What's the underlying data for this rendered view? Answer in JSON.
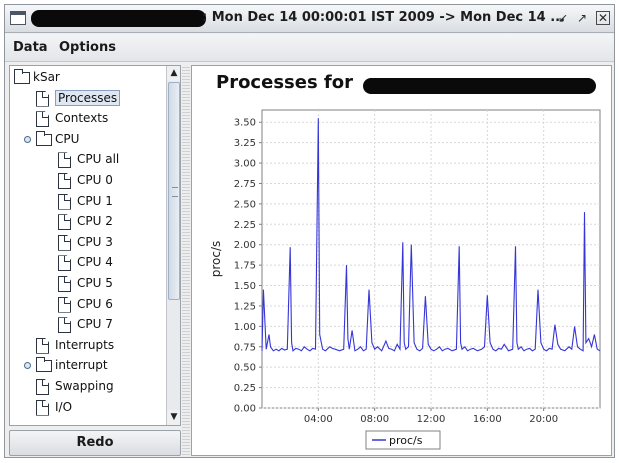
{
  "window": {
    "title": ": Mon Dec 14 00:00:01 IST 2009 -> Mon Dec 14 ..."
  },
  "menu": [
    {
      "label": "Data"
    },
    {
      "label": "Options"
    }
  ],
  "tree": {
    "items": [
      {
        "label": "kSar",
        "icon": "folder-icon",
        "level": 0
      },
      {
        "label": "Processes",
        "icon": "doc-icon",
        "level": 1,
        "selected": true
      },
      {
        "label": "Contexts",
        "icon": "doc-icon",
        "level": 1
      },
      {
        "label": "CPU",
        "icon": "folder-icon",
        "level": 1,
        "expanded": true
      },
      {
        "label": "CPU all",
        "icon": "doc-icon",
        "level": 2
      },
      {
        "label": "CPU 0",
        "icon": "doc-icon",
        "level": 2
      },
      {
        "label": "CPU 1",
        "icon": "doc-icon",
        "level": 2
      },
      {
        "label": "CPU 2",
        "icon": "doc-icon",
        "level": 2
      },
      {
        "label": "CPU 3",
        "icon": "doc-icon",
        "level": 2
      },
      {
        "label": "CPU 4",
        "icon": "doc-icon",
        "level": 2
      },
      {
        "label": "CPU 5",
        "icon": "doc-icon",
        "level": 2
      },
      {
        "label": "CPU 6",
        "icon": "doc-icon",
        "level": 2
      },
      {
        "label": "CPU 7",
        "icon": "doc-icon",
        "level": 2
      },
      {
        "label": "Interrupts",
        "icon": "doc-icon",
        "level": 1
      },
      {
        "label": "interrupt",
        "icon": "folder-icon",
        "level": 1,
        "expanded": false
      },
      {
        "label": "Swapping",
        "icon": "doc-icon",
        "level": 1
      },
      {
        "label": "I/O",
        "icon": "doc-icon",
        "level": 1
      }
    ]
  },
  "redo_label": "Redo",
  "chart_data": {
    "type": "line",
    "title": "Processes for ",
    "ylabel": "proc/s",
    "xlabel": "",
    "ylim": [
      0,
      3.65
    ],
    "y_ticks": [
      "0.00",
      "0.25",
      "0.50",
      "0.75",
      "1.00",
      "1.25",
      "1.50",
      "1.75",
      "2.00",
      "2.25",
      "2.50",
      "2.75",
      "3.00",
      "3.25",
      "3.50"
    ],
    "x_ticks": [
      "04:00",
      "08:00",
      "12:00",
      "16:00",
      "20:00"
    ],
    "x_tick_hours": [
      4,
      8,
      12,
      16,
      20
    ],
    "xlim_hours": [
      0,
      24
    ],
    "grid": true,
    "legend_position": "bottom",
    "color": "#3535d8",
    "series": [
      {
        "name": "proc/s",
        "x_hours": [
          0.0,
          0.1,
          0.3,
          0.5,
          0.6,
          0.8,
          1.0,
          1.2,
          1.4,
          1.6,
          1.8,
          2.0,
          2.1,
          2.2,
          2.4,
          2.6,
          2.8,
          3.0,
          3.2,
          3.4,
          3.6,
          3.8,
          4.0,
          4.1,
          4.3,
          4.5,
          4.8,
          5.0,
          5.2,
          5.5,
          5.8,
          6.0,
          6.1,
          6.2,
          6.4,
          6.6,
          6.8,
          7.0,
          7.2,
          7.4,
          7.6,
          7.8,
          8.0,
          8.2,
          8.5,
          8.8,
          9.0,
          9.2,
          9.4,
          9.6,
          9.8,
          10.0,
          10.1,
          10.2,
          10.4,
          10.6,
          10.8,
          11.0,
          11.2,
          11.4,
          11.6,
          11.8,
          12.0,
          12.2,
          12.4,
          12.6,
          12.8,
          13.0,
          13.2,
          13.5,
          13.8,
          14.0,
          14.1,
          14.2,
          14.4,
          14.6,
          14.8,
          15.0,
          15.3,
          15.6,
          15.8,
          16.0,
          16.2,
          16.4,
          16.6,
          16.8,
          17.0,
          17.2,
          17.5,
          17.8,
          18.0,
          18.1,
          18.2,
          18.4,
          18.6,
          18.8,
          19.0,
          19.2,
          19.4,
          19.6,
          19.8,
          20.0,
          20.2,
          20.4,
          20.6,
          20.8,
          21.0,
          21.2,
          21.5,
          21.8,
          22.0,
          22.2,
          22.4,
          22.6,
          22.8,
          22.9,
          23.0,
          23.2,
          23.4,
          23.6,
          23.8,
          24.0
        ],
        "values": [
          0.7,
          1.45,
          0.72,
          0.9,
          0.75,
          0.7,
          0.72,
          0.7,
          0.73,
          0.71,
          0.72,
          1.97,
          0.8,
          0.7,
          0.73,
          0.72,
          0.7,
          0.75,
          0.72,
          0.7,
          0.73,
          0.72,
          3.55,
          0.9,
          0.72,
          0.7,
          0.75,
          0.73,
          0.72,
          0.7,
          0.72,
          1.75,
          0.85,
          0.72,
          0.95,
          0.7,
          0.72,
          0.75,
          0.7,
          0.72,
          1.45,
          0.8,
          0.72,
          0.75,
          0.7,
          0.82,
          0.73,
          0.72,
          0.7,
          0.78,
          0.72,
          2.03,
          0.8,
          0.72,
          0.75,
          2.0,
          0.8,
          0.72,
          0.7,
          0.73,
          1.37,
          0.78,
          0.72,
          0.7,
          0.72,
          0.75,
          0.7,
          0.72,
          0.73,
          0.7,
          0.72,
          1.98,
          0.8,
          0.72,
          0.75,
          0.7,
          0.72,
          0.73,
          0.7,
          0.72,
          0.75,
          1.38,
          0.8,
          0.72,
          0.7,
          0.73,
          0.72,
          0.78,
          0.7,
          0.72,
          1.98,
          0.8,
          0.72,
          0.75,
          0.7,
          0.72,
          0.73,
          0.7,
          0.72,
          1.45,
          0.8,
          0.72,
          0.7,
          0.73,
          0.72,
          1.02,
          0.78,
          0.72,
          0.7,
          0.75,
          0.72,
          1.0,
          0.75,
          0.72,
          0.7,
          2.4,
          0.8,
          0.85,
          0.75,
          0.9,
          0.72,
          0.7
        ]
      }
    ]
  }
}
